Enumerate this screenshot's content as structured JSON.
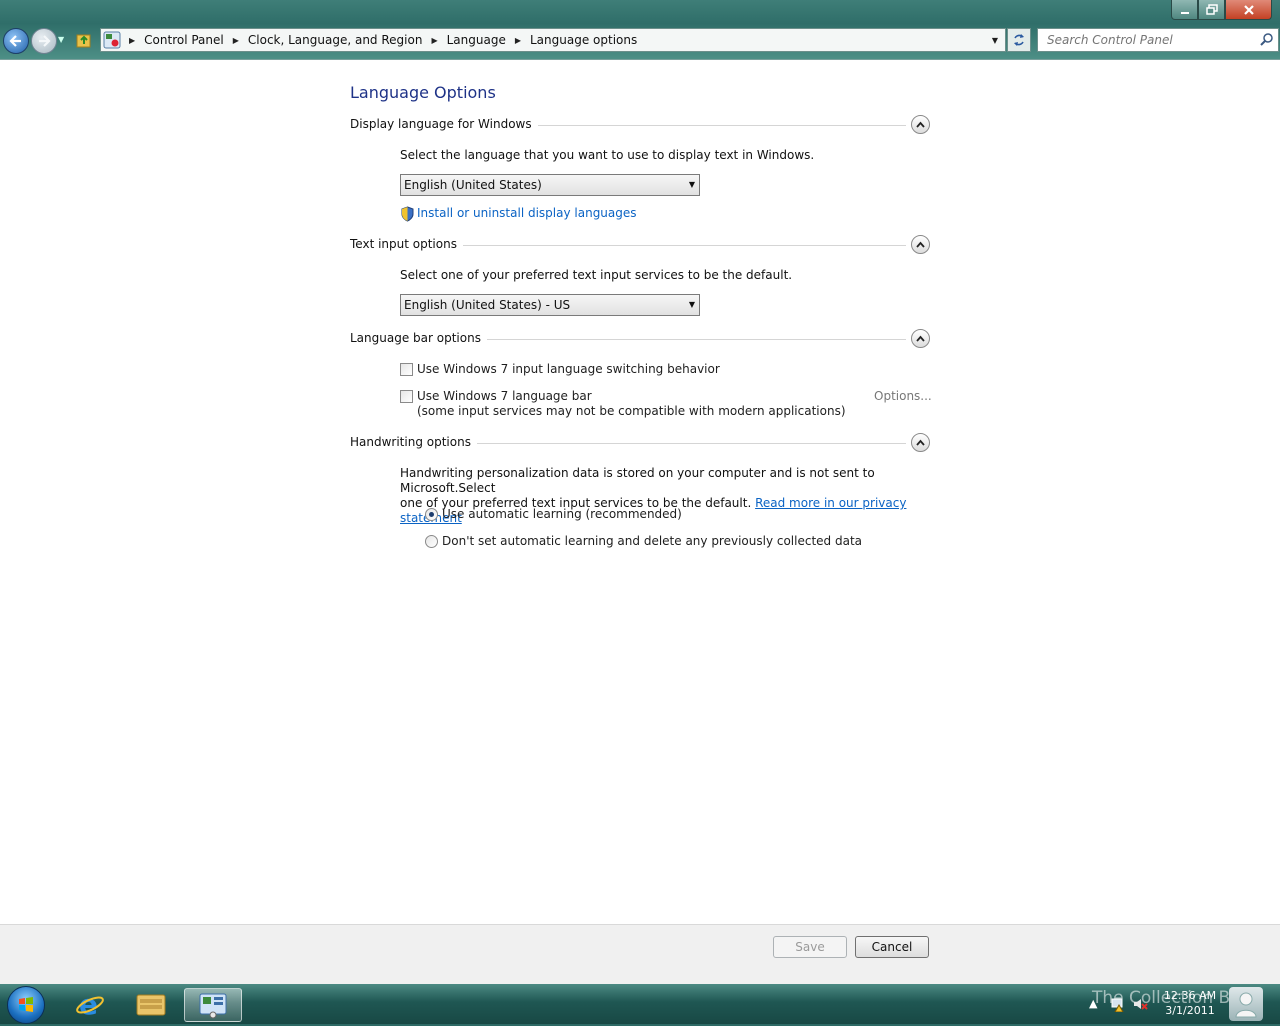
{
  "window": {
    "minimize_icon": "minimize-icon",
    "maximize_icon": "restore-icon",
    "close_icon": "close-icon"
  },
  "address_bar": {
    "breadcrumbs": [
      "Control Panel",
      "Clock, Language, and Region",
      "Language",
      "Language options"
    ],
    "search_placeholder": "Search Control Panel"
  },
  "page": {
    "title": "Language Options"
  },
  "display_language": {
    "heading": "Display language for Windows",
    "description": "Select the language that you want to use to display text in Windows.",
    "selected": "English (United States)",
    "link": "Install or uninstall display languages"
  },
  "text_input": {
    "heading": "Text input options",
    "description": "Select one of your preferred text input services to be the default.",
    "selected": "English (United States) - US"
  },
  "language_bar": {
    "heading": "Language bar options",
    "switching_label": "Use Windows 7 input language switching behavior",
    "switching_checked": false,
    "langbar_label": "Use Windows 7 language bar",
    "langbar_note": "(some input services may not be compatible with modern applications)",
    "langbar_checked": false,
    "options_label": "Options..."
  },
  "handwriting": {
    "heading": "Handwriting options",
    "description_line1": "Handwriting personalization data is stored on your computer and is not sent to Microsoft.Select",
    "description_line2": "one of your preferred text input services to be the default.",
    "privacy_link": "Read more in our privacy statement",
    "option_auto": "Use automatic learning (recommended)",
    "option_none": "Don't set automatic learning and delete any previously collected data",
    "selected_option": "auto"
  },
  "buttons": {
    "save": "Save",
    "cancel": "Cancel"
  },
  "taskbar": {
    "time": "12:36 AM",
    "date": "3/1/2011",
    "watermark": "The Collection Book"
  }
}
